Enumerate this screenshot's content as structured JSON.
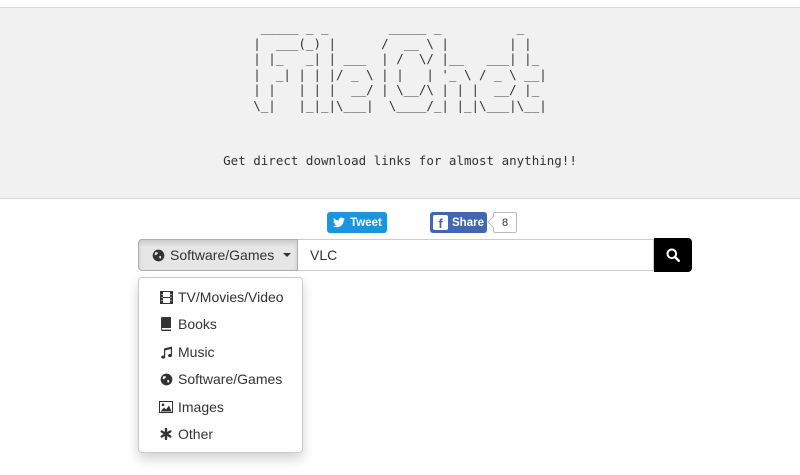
{
  "banner": {
    "ascii_art": " _____ _ _        _____ _          _   \n|  ___(_) |      /  __ \\ |        | |  \n| |_   _| | ___  | /  \\/ |__   ___| |_ \n|  _| | | |/ _ \\ | |   | '_ \\ / _ \\ __|\n| |   | | |  __/ | \\__/\\ | | |  __/ |_ \n\\_|   |_|_|\\___|  \\____/_| |_|\\___|\\__|",
    "tagline": "Get direct download links for almost anything!!"
  },
  "social": {
    "tweet_label": "Tweet",
    "share_label": "Share",
    "share_count": "8"
  },
  "search": {
    "category_label": "Software/Games",
    "category_icon": "globe-icon",
    "query": "VLC",
    "button_icon": "search-icon"
  },
  "menu": {
    "items": [
      {
        "label": "TV/Movies/Video",
        "icon": "film-icon"
      },
      {
        "label": "Books",
        "icon": "book-icon"
      },
      {
        "label": "Music",
        "icon": "music-icon"
      },
      {
        "label": "Software/Games",
        "icon": "globe-icon"
      },
      {
        "label": "Images",
        "icon": "picture-icon"
      },
      {
        "label": "Other",
        "icon": "asterisk-icon"
      }
    ]
  },
  "colors": {
    "tweet": "#1b95e0",
    "facebook": "#4267b2",
    "search_button": "#000000",
    "header_bg": "#f1f1f1"
  }
}
